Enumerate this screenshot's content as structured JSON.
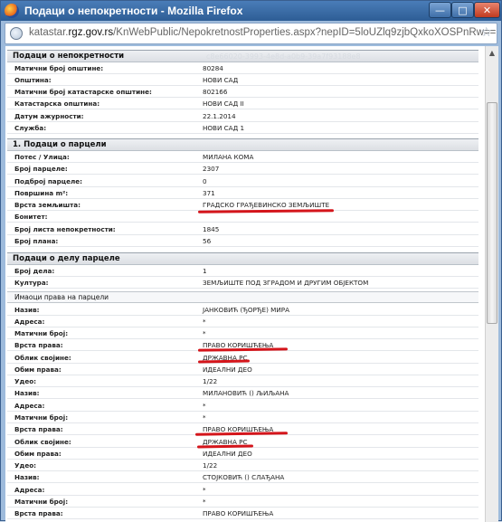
{
  "window": {
    "title": "Подаци о непокретности - Mozilla Firefox",
    "min": "—",
    "max": "□",
    "close": "✕"
  },
  "url": {
    "prefix": "katastar.",
    "domain": "rgz.gov.rs",
    "path": "/KnWebPublic/NepokretnostProperties.aspx?nepID=5loUZlq9zjbQxkoXOSPnRw=="
  },
  "sections": {
    "s0": {
      "title": "Подаци о непокретности",
      "guid": "c8e66020-3993-4e8d-a0b9-39a7f93188e8"
    },
    "s1": {
      "title": "1. Подаци о парцели"
    },
    "s2": {
      "title": "Подаци о делу парцеле"
    }
  },
  "rows": {
    "r1": {
      "label": "Матични број општине:",
      "value": "80284"
    },
    "r2": {
      "label": "Општина:",
      "value": "НОВИ САД"
    },
    "r3": {
      "label": "Матични број катастарске општине:",
      "value": "802166"
    },
    "r4": {
      "label": "Катастарска општина:",
      "value": "НОВИ САД II"
    },
    "r5": {
      "label": "Датум ажурности:",
      "value": "22.1.2014"
    },
    "r6": {
      "label": "Служба:",
      "value": "НОВИ САД 1"
    },
    "r7": {
      "label": "Потес / Улица:",
      "value": "МИЛАНА КОМА"
    },
    "r8": {
      "label": "Број парцеле:",
      "value": "2307"
    },
    "r9": {
      "label": "Подброј парцеле:",
      "value": "0"
    },
    "r10": {
      "label": "Површина m²:",
      "value": "371"
    },
    "r11": {
      "label": "Врста земљишта:",
      "value": "ГРАДСКО ГРАЂЕВИНСКО ЗЕМЉИШТЕ"
    },
    "r12": {
      "label": "Бонитет:",
      "value": ""
    },
    "r13": {
      "label": "Број листа непокретности:",
      "value": "1845"
    },
    "r14": {
      "label": "Број плана:",
      "value": "56"
    },
    "r15": {
      "label": "Број дела:",
      "value": "1"
    },
    "r16": {
      "label": "Култура:",
      "value": "ЗЕМЉИШТЕ ПОД ЗГРАДОМ И ДРУГИМ ОБЈЕКТОМ"
    },
    "sub": {
      "label": "Имаоци права на парцели"
    },
    "r17": {
      "label": "Назив:",
      "value": "ЈАНКОВИЋ (ЂОРЂЕ) МИРА"
    },
    "r18": {
      "label": "Адреса:",
      "value": "*"
    },
    "r19": {
      "label": "Матични број:",
      "value": "*"
    },
    "r20": {
      "label": "Врста права:",
      "value": "ПРАВО КОРИШЋЕЊА"
    },
    "r21": {
      "label": "Облик својине:",
      "value": "ДРЖАВНА РС"
    },
    "r22": {
      "label": "Обим права:",
      "value": "ИДЕАЛНИ ДЕО"
    },
    "r23": {
      "label": "Удео:",
      "value": "1/22"
    },
    "r24": {
      "label": "Назив:",
      "value": "МИЛАНОВИЋ () ЉИЉАНА"
    },
    "r25": {
      "label": "Адреса:",
      "value": "*"
    },
    "r26": {
      "label": "Матични број:",
      "value": "*"
    },
    "r27": {
      "label": "Врста права:",
      "value": "ПРАВО КОРИШЋЕЊА"
    },
    "r28": {
      "label": "Облик својине:",
      "value": "ДРЖАВНА РС"
    },
    "r29": {
      "label": "Обим права:",
      "value": "ИДЕАЛНИ ДЕО"
    },
    "r30": {
      "label": "Удео:",
      "value": "1/22"
    },
    "r31": {
      "label": "Назив:",
      "value": "СТОЈКОВИЋ () СЛАЂАНА"
    },
    "r32": {
      "label": "Адреса:",
      "value": "*"
    },
    "r33": {
      "label": "Матични број:",
      "value": "*"
    },
    "r34": {
      "label": "Врста права:",
      "value": "ПРАВО КОРИШЋЕЊА"
    }
  },
  "icons": {
    "app": "firefox-icon",
    "site": "globe-icon",
    "bookmark": "star-icon"
  },
  "colors": {
    "annotation": "#d4151b",
    "titlebar": "#2d5d95"
  }
}
